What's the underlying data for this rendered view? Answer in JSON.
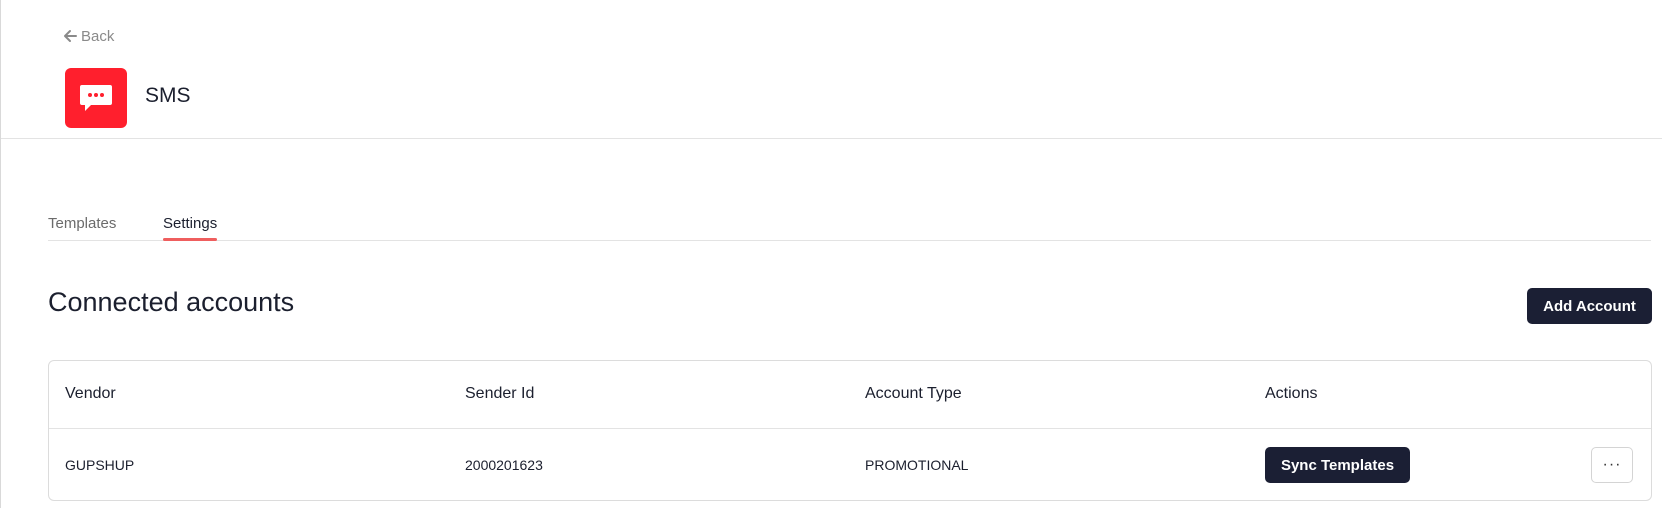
{
  "header": {
    "back_label": "Back",
    "app_icon": "sms-chat-icon",
    "app_title": "SMS",
    "app_icon_color": "#ff1f2d"
  },
  "tabs": [
    {
      "label": "Templates",
      "active": false
    },
    {
      "label": "Settings",
      "active": true
    }
  ],
  "section": {
    "title": "Connected accounts",
    "add_button_label": "Add Account"
  },
  "table": {
    "columns": [
      "Vendor",
      "Sender Id",
      "Account Type",
      "Actions"
    ],
    "rows": [
      {
        "vendor": "GUPSHUP",
        "sender_id": "2000201623",
        "account_type": "PROMOTIONAL",
        "action_label": "Sync Templates",
        "more_label": "···"
      }
    ]
  },
  "colors": {
    "accent": "#ef5e5e",
    "primary_button": "#1b1f34"
  }
}
